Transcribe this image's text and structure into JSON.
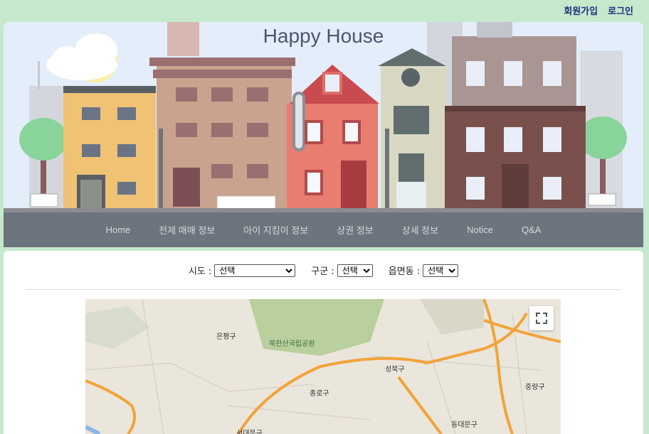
{
  "header": {
    "links": [
      {
        "label": "회원가입"
      },
      {
        "label": "로그인"
      }
    ]
  },
  "hero": {
    "title": "Happy House"
  },
  "nav": {
    "items": [
      {
        "label": "Home"
      },
      {
        "label": "전제 매매 정보"
      },
      {
        "label": "아이 지킴이 정보"
      },
      {
        "label": "상권 정보"
      },
      {
        "label": "상세 정보"
      },
      {
        "label": "Notice"
      },
      {
        "label": "Q&A"
      }
    ]
  },
  "filters": {
    "sido": {
      "label": "시도 :",
      "selected": "선택"
    },
    "gugun": {
      "label": "구군 :",
      "selected": "선택"
    },
    "dong": {
      "label": "읍면동 :",
      "selected": "선택"
    }
  },
  "map": {
    "labels": {
      "eunpyeong": "은평구",
      "bukhansan": "북한산국립공원",
      "seongbuk": "성북구",
      "jongno": "종로구",
      "jungnang": "중랑구",
      "dongdaemun": "동대문구",
      "seodaemun": "서대문구"
    },
    "colors": {
      "road": "#f2a33a",
      "park": "#b9cf9d",
      "land": "#ebe6dc"
    }
  },
  "colors": {
    "background": "#c6e8cc",
    "nav_bg": "#6c747d",
    "title": "#4a5670",
    "link": "#1d2f7a"
  }
}
